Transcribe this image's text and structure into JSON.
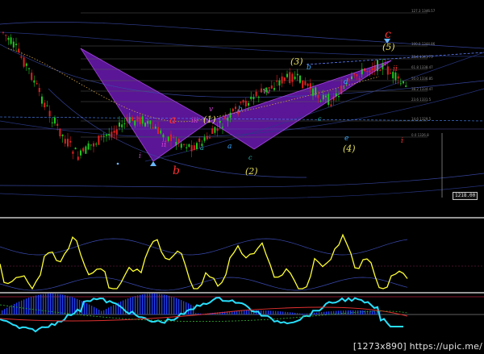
{
  "watermark": "[1273x890] https://upic.me/",
  "price_tag": "1218.00",
  "fib_levels": [
    {
      "label": "127.3 1346.57"
    },
    {
      "label": "100.0 1344.86"
    },
    {
      "label": "78.6 1341.75"
    },
    {
      "label": "61.8 1338.47"
    },
    {
      "label": "50.0 1336.85"
    },
    {
      "label": "38.2 1334.47"
    },
    {
      "label": "23.6 1331.5"
    },
    {
      "label": "14.6 1329.5"
    },
    {
      "label": "0.0 1326.8"
    }
  ],
  "wave_labels": {
    "a": "a",
    "b": "b",
    "c": "c",
    "d": "d",
    "w1": "(1)",
    "w2": "(2)",
    "w3": "(3)",
    "w4": "(4)",
    "w5": "(5)",
    "minor_i": "i",
    "minor_ii": "ii",
    "minor_iii": "iii",
    "minor_iv": "iv",
    "minor_v": "v",
    "small_a": "a",
    "small_b": "b",
    "small_c": "c",
    "small_d": "d",
    "small_e": "e"
  },
  "colors": {
    "background": "#000000",
    "bull_candle": "#1ec81e",
    "bear_candle": "#e02020",
    "harmonic_fill": "#6a1ab0",
    "wave_yellow": "#e8e060",
    "wave_red": "#ff3030",
    "oscillator_line": "#ffff33",
    "macd_line": "#28e0ff",
    "macd_hist": "#2040ff"
  },
  "panels": [
    "price",
    "oscillator",
    "macd"
  ]
}
